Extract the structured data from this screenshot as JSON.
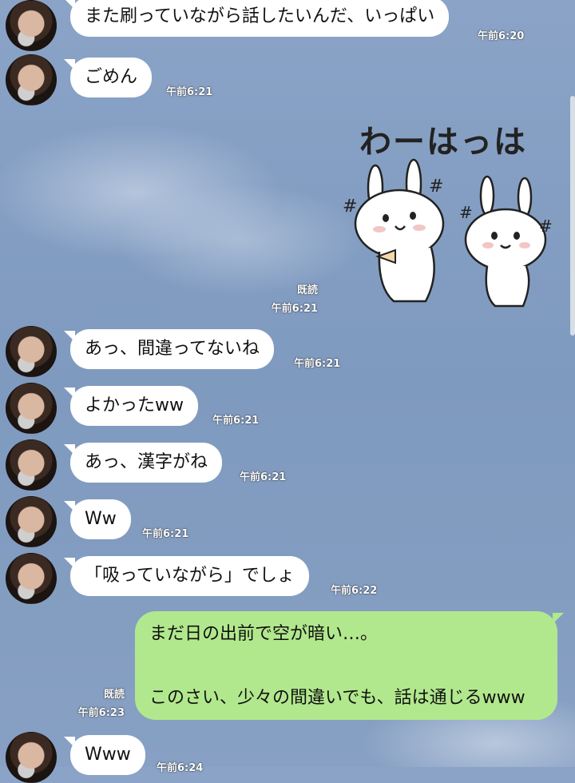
{
  "messages": [
    {
      "text": "また刷っていながら話したいんだ、いっぱい",
      "time": "午前6:20"
    },
    {
      "text": "ごめん",
      "time": "午前6:21"
    },
    {
      "sticker_caption": "わーはっは",
      "read": "既読",
      "time": "午前6:21"
    },
    {
      "text": "あっ、間違ってないね",
      "time": "午前6:21"
    },
    {
      "text": "よかったww",
      "time": "午前6:21"
    },
    {
      "text": "あっ、漢字がね",
      "time": "午前6:21"
    },
    {
      "text": "Ww",
      "time": "午前6:21"
    },
    {
      "text": "「吸っていながら」でしょ",
      "time": "午前6:22"
    },
    {
      "line1": "まだ日の出前で空が暗い…。",
      "line2": "このさい、少々の間違いでも、話は通じるwww",
      "read": "既読",
      "time": "午前6:23"
    },
    {
      "text": "Www",
      "time": "午前6:24"
    }
  ]
}
